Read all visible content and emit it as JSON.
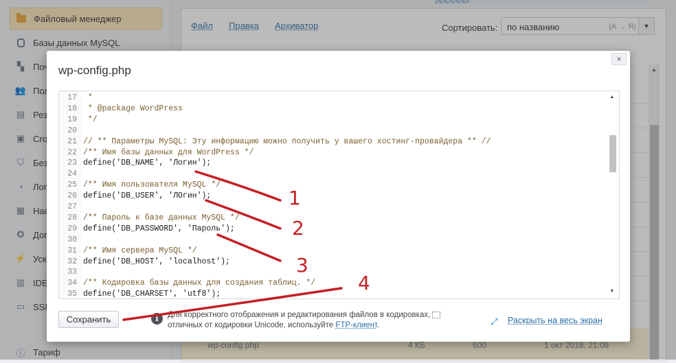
{
  "sidebar": {
    "items": [
      {
        "label": "Файловый менеджер",
        "icon": "folder-icon",
        "active": true
      },
      {
        "label": "Базы данных MySQL",
        "icon": "database-icon"
      },
      {
        "label": "Поч",
        "icon": "mail-icon"
      },
      {
        "label": "Пол",
        "icon": "users-icon"
      },
      {
        "label": "Рез",
        "icon": "backup-icon"
      },
      {
        "label": "Cro",
        "icon": "cron-icon"
      },
      {
        "label": "Без",
        "icon": "shield-icon"
      },
      {
        "label": "Лог",
        "icon": "logs-icon"
      },
      {
        "label": "Нас",
        "icon": "settings-icon"
      },
      {
        "label": "Доп",
        "icon": "badge-icon"
      },
      {
        "label": "Уск",
        "icon": "speed-icon"
      },
      {
        "label": "IDE",
        "icon": "ide-icon"
      },
      {
        "label": "SSH",
        "icon": "terminal-icon"
      }
    ],
    "bottom_item": {
      "label": "Тариф",
      "icon": "tariff-icon"
    }
  },
  "toolbar": {
    "menu": [
      "Файл",
      "Правка",
      "Архиватор"
    ],
    "sort_label": "Сортировать:",
    "sort_value": "по названию",
    "sort_hint": "(А → Я)"
  },
  "background_file": {
    "name": "wp-config.php",
    "size": "4 КБ",
    "perms": "600",
    "date": "1 окт 2018, 21:08"
  },
  "modal": {
    "title": "wp-config.php",
    "close_label": "×",
    "save_label": "Сохранить",
    "info_line1": "Для корректного отображения и редактирования файлов в кодировках,",
    "info_line2_prefix": "отличных от кодировки Unicode, используйте ",
    "info_line2_link": "FTP-клиент",
    "info_line2_suffix": ".",
    "fullscreen_label": "Раскрыть на весь экран"
  },
  "code_lines": [
    {
      "n": "17",
      "t": " *"
    },
    {
      "n": "18",
      "t": " * @package WordPress"
    },
    {
      "n": "19",
      "t": " */"
    },
    {
      "n": "20",
      "t": ""
    },
    {
      "n": "21",
      "t": "// ** Параметры MySQL: Эту информацию можно получить у вашего хостинг-провайдера ** //"
    },
    {
      "n": "22",
      "t": "/** Имя базы данных для WordPress */"
    },
    {
      "n": "23",
      "t": "define('DB_NAME', 'Логин');"
    },
    {
      "n": "24",
      "t": ""
    },
    {
      "n": "25",
      "t": "/** Имя пользователя MySQL */"
    },
    {
      "n": "26",
      "t": "define('DB_USER', 'ЛОгин');"
    },
    {
      "n": "27",
      "t": ""
    },
    {
      "n": "28",
      "t": "/** Пароль к базе данных MySQL */"
    },
    {
      "n": "29",
      "t": "define('DB_PASSWORD', 'Пароль');"
    },
    {
      "n": "30",
      "t": ""
    },
    {
      "n": "31",
      "t": "/** Имя сервера MySQL */"
    },
    {
      "n": "32",
      "t": "define('DB_HOST', 'localhost');"
    },
    {
      "n": "33",
      "t": ""
    },
    {
      "n": "34",
      "t": "/** Кодировка базы данных для создания таблиц. */"
    },
    {
      "n": "35",
      "t": "define('DB_CHARSET', 'utf8');"
    }
  ],
  "annotations": {
    "color": "#c31f24",
    "numbers": [
      "1",
      "2",
      "3",
      "4"
    ]
  }
}
